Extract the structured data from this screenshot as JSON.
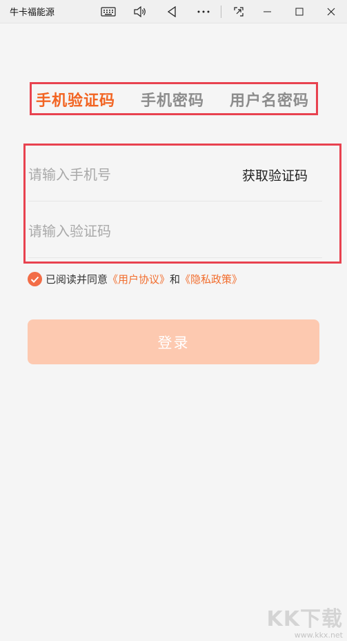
{
  "window": {
    "title": "牛卡福能源",
    "icons": [
      "keyboard-icon",
      "volume-icon",
      "back-icon",
      "more-icon",
      "screenshot-icon",
      "minimize-icon",
      "maximize-icon",
      "close-icon"
    ]
  },
  "tabs": [
    {
      "label": "手机验证码",
      "active": true
    },
    {
      "label": "手机密码",
      "active": false
    },
    {
      "label": "用户名密码",
      "active": false
    }
  ],
  "form": {
    "phone_placeholder": "请输入手机号",
    "code_placeholder": "请输入验证码",
    "get_code_label": "获取验证码"
  },
  "agreement": {
    "checked": true,
    "prefix": "已阅读并同意",
    "user_agreement": "《用户协议》",
    "conjunction": "和",
    "privacy_policy": "《隐私政策》"
  },
  "login": {
    "label": "登录"
  },
  "watermark": {
    "logo": "KK下载",
    "url": "www.kkx.net"
  },
  "colors": {
    "accent": "#f26422",
    "link": "#f26d2d",
    "annotation_border": "#e8424f",
    "login_button": "#fdc9b0",
    "background": "#f5f5f5"
  }
}
